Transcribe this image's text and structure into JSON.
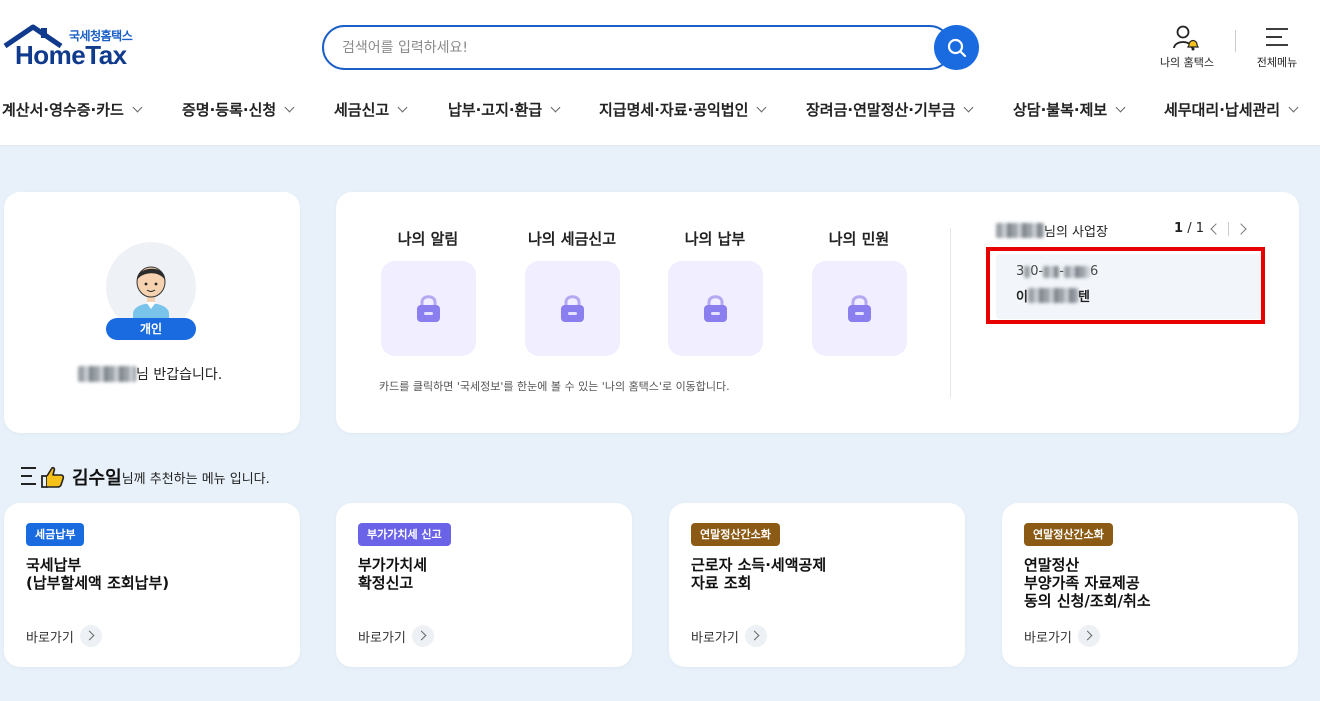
{
  "header": {
    "logo_sub": "국세청홈택스",
    "logo_main": "HomeTax",
    "search_placeholder": "검색어를 입력하세요!",
    "my_hometax_label": "나의 홈택스",
    "all_menu_label": "전체메뉴"
  },
  "gnb": {
    "items": [
      "계산서·영수증·카드",
      "증명·등록·신청",
      "세금신고",
      "납부·고지·환급",
      "지급명세·자료·공익법인",
      "장려금·연말정산·기부금",
      "상담·불복·제보",
      "세무대리·납세관리"
    ]
  },
  "profile": {
    "type_badge": "개인",
    "greeting_suffix": "님 반갑습니다."
  },
  "my_items": [
    "나의 알림",
    "나의 세금신고",
    "나의 납부",
    "나의 민원"
  ],
  "hint": "카드를 클릭하면 '국세정보'를 한눈에 볼 수 있는 '나의 홈택스'로 이동합니다.",
  "business": {
    "title_suffix": "님의 사업장",
    "page_current": "1",
    "page_total": "/ 1",
    "number_prefix": "3",
    "number_mid": "0-",
    "number_sep": "-",
    "number_suffix": "6",
    "name_prefix": "이",
    "name_suffix": "텐",
    "highlight_color": "#e60000"
  },
  "recommend": {
    "user_name": "김수일",
    "title_suffix": "님께 추천하는 메뉴 입니다.",
    "goto_label": "바로가기",
    "cards": [
      {
        "tag": "세금납부",
        "tag_color": "#1a6be0",
        "name": "국세납부\n(납부할세액 조회납부)"
      },
      {
        "tag": "부가가치세 신고",
        "tag_color": "#6a63e8",
        "name": "부가가치세\n확정신고"
      },
      {
        "tag": "연말정산간소화",
        "tag_color": "#8b5a14",
        "name": "근로자 소득·세액공제\n자료 조회"
      },
      {
        "tag": "연말정산간소화",
        "tag_color": "#8b5a14",
        "name": "연말정산\n부양가족 자료제공\n동의 신청/조회/취소"
      }
    ]
  }
}
